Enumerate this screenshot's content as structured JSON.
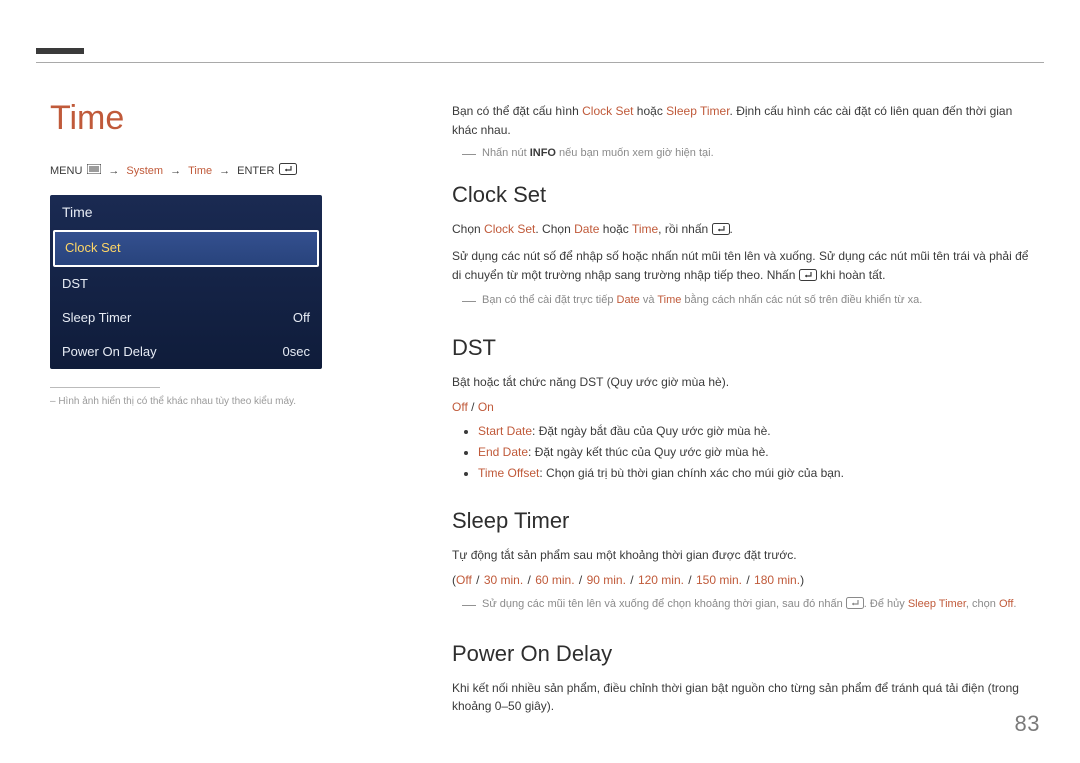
{
  "pageNumber": "83",
  "left": {
    "title": "Time",
    "breadcrumb": {
      "menu": "MENU",
      "sep": "→",
      "system": "System",
      "time": "Time",
      "enter": "ENTER"
    },
    "osd": {
      "header": "Time",
      "clockSet": "Clock Set",
      "dst": "DST",
      "sleepTimer": {
        "label": "Sleep Timer",
        "value": "Off"
      },
      "powerOnDelay": {
        "label": "Power On Delay",
        "value": "0sec"
      }
    },
    "footnote": "– Hình ảnh hiển thị có thể khác nhau tùy theo kiểu máy."
  },
  "right": {
    "intro": {
      "p1a": "Bạn có thể đặt cấu hình ",
      "p1b": "Clock Set",
      "p1c": " hoặc ",
      "p1d": "Sleep Timer",
      "p1e": ". Định cấu hình các cài đặt có liên quan đến thời gian khác nhau.",
      "note1a": "Nhấn nút ",
      "note1b": "INFO",
      "note1c": " nếu bạn muốn xem giờ hiện tại."
    },
    "clockSet": {
      "h": "Clock Set",
      "p1a": "Chọn ",
      "p1b": "Clock Set",
      "p1c": ". Chọn ",
      "p1d": "Date",
      "p1e": " hoặc ",
      "p1f": "Time",
      "p1g": ", rồi nhấn ",
      "p2a": "Sử dụng các nút số để nhập số hoặc nhấn nút mũi tên lên và xuống. Sử dụng các nút mũi tên trái và phải để di chuyển từ một trường nhập sang trường nhập tiếp theo. Nhấn ",
      "p2b": " khi hoàn tất.",
      "note2a": "Bạn có thể cài đặt trực tiếp ",
      "note2b": "Date",
      "note2c": " và ",
      "note2d": "Time",
      "note2e": " bằng cách nhấn các nút số trên điều khiển từ xa."
    },
    "dst": {
      "h": "DST",
      "p1": "Bật hoặc tắt chức năng DST (Quy ước giờ mùa hè).",
      "off": "Off",
      "slash": " / ",
      "on": "On",
      "li1a": "Start Date",
      "li1b": ": Đặt ngày bắt đầu của Quy ước giờ mùa hè.",
      "li2a": "End Date",
      "li2b": ": Đặt ngày kết thúc của Quy ước giờ mùa hè.",
      "li3a": "Time Offset",
      "li3b": ": Chọn giá trị bù thời gian chính xác cho múi giờ của bạn."
    },
    "sleepTimer": {
      "h": "Sleep Timer",
      "p1": "Tự động tắt sản phẩm sau một khoảng thời gian được đặt trước.",
      "opts": {
        "open": "(",
        "off": "Off",
        "s": " / ",
        "o1": "30 min.",
        "o2": "60 min.",
        "o3": "90 min.",
        "o4": "120 min.",
        "o5": "150 min.",
        "o6": "180 min.",
        "close": ")"
      },
      "note3a": "Sử dụng các mũi tên lên và xuống để chọn khoảng thời gian, sau đó nhấn ",
      "note3b": ". Để hủy ",
      "note3c": "Sleep Timer",
      "note3d": ", chọn ",
      "note3e": "Off",
      "note3f": "."
    },
    "powerOnDelay": {
      "h": "Power On Delay",
      "p1": "Khi kết nối nhiều sản phẩm, điều chỉnh thời gian bật nguồn cho từng sản phẩm để tránh quá tải điện (trong khoảng 0–50 giây)."
    }
  }
}
